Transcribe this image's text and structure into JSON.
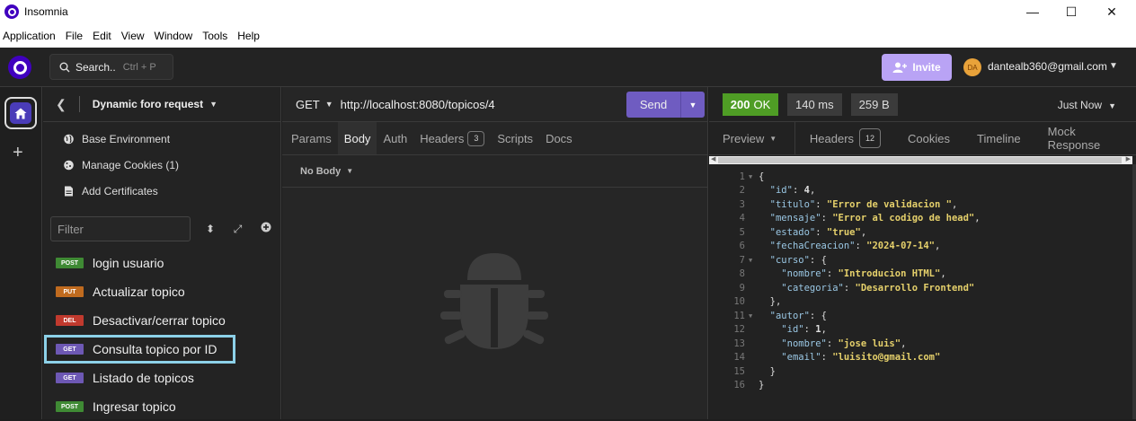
{
  "window": {
    "title": "Insomnia",
    "controls": {
      "minimize": "—",
      "maximize": "☐",
      "close": "✕"
    }
  },
  "menu": [
    "Application",
    "File",
    "Edit",
    "View",
    "Window",
    "Tools",
    "Help"
  ],
  "topbar": {
    "search_label": "Search..",
    "search_shortcut": "Ctrl + P",
    "invite_label": "Invite",
    "avatar_initials": "DA",
    "email": "dantealb360@gmail.com"
  },
  "sidebar": {
    "workspace_name": "Dynamic foro request",
    "env_items": [
      {
        "label": "Base Environment",
        "icon": "globe-icon"
      },
      {
        "label": "Manage Cookies (1)",
        "icon": "cookie-icon"
      },
      {
        "label": "Add Certificates",
        "icon": "certificate-icon"
      }
    ],
    "filter_placeholder": "Filter",
    "requests": [
      {
        "method": "POST",
        "name": "login usuario",
        "color": "#3f8a34"
      },
      {
        "method": "PUT",
        "name": "Actualizar topico",
        "color": "#c06b1f"
      },
      {
        "method": "DEL",
        "name": "Desactivar/cerrar topico",
        "color": "#c13a2e"
      },
      {
        "method": "GET",
        "name": "Consulta topico por ID",
        "color": "#6d58b4",
        "active": true
      },
      {
        "method": "GET",
        "name": "Listado de topicos",
        "color": "#6d58b4"
      },
      {
        "method": "POST",
        "name": "Ingresar topico",
        "color": "#3f8a34"
      }
    ]
  },
  "request": {
    "method": "GET",
    "url": "http://localhost:8080/topicos/4",
    "send_label": "Send",
    "tabs": [
      {
        "label": "Params"
      },
      {
        "label": "Body",
        "active": true
      },
      {
        "label": "Auth"
      },
      {
        "label": "Headers",
        "count": "3"
      },
      {
        "label": "Scripts"
      },
      {
        "label": "Docs"
      }
    ],
    "body_type": "No Body"
  },
  "response": {
    "status_code": "200",
    "status_text": "OK",
    "time": "140 ms",
    "size": "259 B",
    "timestamp": "Just Now",
    "tabs": [
      {
        "label": "Preview"
      },
      {
        "label": "Headers",
        "count": "12"
      },
      {
        "label": "Cookies"
      },
      {
        "label": "Timeline"
      },
      {
        "label": "Mock Response"
      }
    ],
    "lines": [
      {
        "n": "1",
        "fold": true,
        "indent": "",
        "parts": [
          [
            "punct",
            "{"
          ]
        ]
      },
      {
        "n": "2",
        "indent": "  ",
        "parts": [
          [
            "key",
            "\"id\""
          ],
          [
            "punct",
            ": "
          ],
          [
            "num-v",
            "4"
          ],
          [
            "punct",
            ","
          ]
        ]
      },
      {
        "n": "3",
        "indent": "  ",
        "parts": [
          [
            "key",
            "\"titulo\""
          ],
          [
            "punct",
            ": "
          ],
          [
            "str",
            "\"Error de validacion \""
          ],
          [
            "punct",
            ","
          ]
        ]
      },
      {
        "n": "4",
        "indent": "  ",
        "parts": [
          [
            "key",
            "\"mensaje\""
          ],
          [
            "punct",
            ": "
          ],
          [
            "str",
            "\"Error al codigo de head\""
          ],
          [
            "punct",
            ","
          ]
        ]
      },
      {
        "n": "5",
        "indent": "  ",
        "parts": [
          [
            "key",
            "\"estado\""
          ],
          [
            "punct",
            ": "
          ],
          [
            "str",
            "\"true\""
          ],
          [
            "punct",
            ","
          ]
        ]
      },
      {
        "n": "6",
        "indent": "  ",
        "parts": [
          [
            "key",
            "\"fechaCreacion\""
          ],
          [
            "punct",
            ": "
          ],
          [
            "str",
            "\"2024-07-14\""
          ],
          [
            "punct",
            ","
          ]
        ]
      },
      {
        "n": "7",
        "fold": true,
        "indent": "  ",
        "parts": [
          [
            "key",
            "\"curso\""
          ],
          [
            "punct",
            ": {"
          ]
        ]
      },
      {
        "n": "8",
        "indent": "    ",
        "parts": [
          [
            "key",
            "\"nombre\""
          ],
          [
            "punct",
            ": "
          ],
          [
            "str",
            "\"Introducion HTML\""
          ],
          [
            "punct",
            ","
          ]
        ]
      },
      {
        "n": "9",
        "indent": "    ",
        "parts": [
          [
            "key",
            "\"categoria\""
          ],
          [
            "punct",
            ": "
          ],
          [
            "str",
            "\"Desarrollo Frontend\""
          ]
        ]
      },
      {
        "n": "10",
        "indent": "  ",
        "parts": [
          [
            "punct",
            "},"
          ]
        ]
      },
      {
        "n": "11",
        "fold": true,
        "indent": "  ",
        "parts": [
          [
            "key",
            "\"autor\""
          ],
          [
            "punct",
            ": {"
          ]
        ]
      },
      {
        "n": "12",
        "indent": "    ",
        "parts": [
          [
            "key",
            "\"id\""
          ],
          [
            "punct",
            ": "
          ],
          [
            "num-v",
            "1"
          ],
          [
            "punct",
            ","
          ]
        ]
      },
      {
        "n": "13",
        "indent": "    ",
        "parts": [
          [
            "key",
            "\"nombre\""
          ],
          [
            "punct",
            ": "
          ],
          [
            "str",
            "\"jose luis\""
          ],
          [
            "punct",
            ","
          ]
        ]
      },
      {
        "n": "14",
        "indent": "    ",
        "parts": [
          [
            "key",
            "\"email\""
          ],
          [
            "punct",
            ": "
          ],
          [
            "str",
            "\"luisito@gmail.com\""
          ]
        ]
      },
      {
        "n": "15",
        "indent": "  ",
        "parts": [
          [
            "punct",
            "}"
          ]
        ]
      },
      {
        "n": "16",
        "indent": "",
        "parts": [
          [
            "punct",
            "}"
          ]
        ]
      }
    ]
  }
}
